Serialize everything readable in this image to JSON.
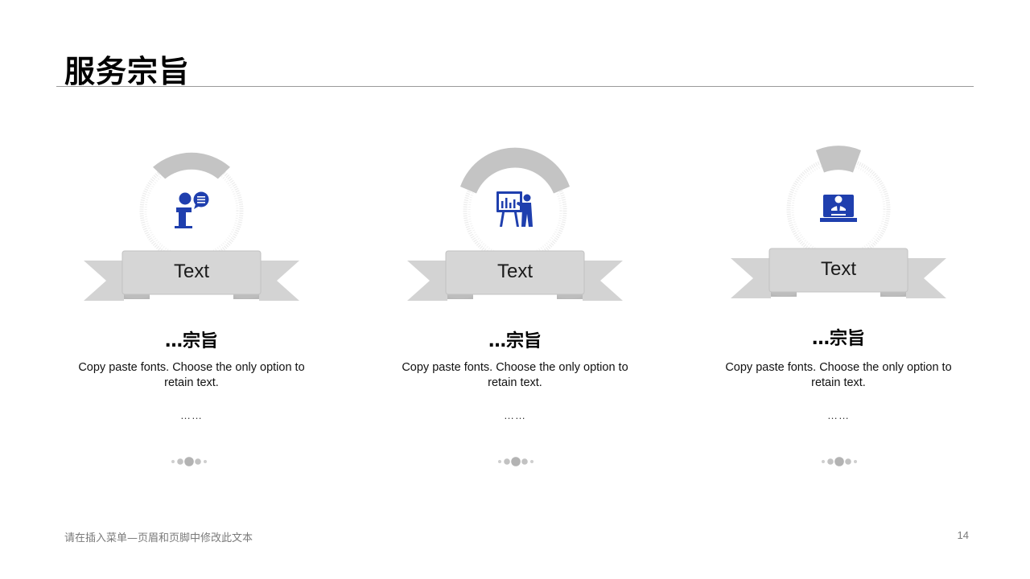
{
  "slide": {
    "title": "服务宗旨",
    "footer": "请在插入菜单—页眉和页脚中修改此文本",
    "page_number": "14"
  },
  "colors": {
    "accent": "#1f3fae",
    "ribbon": "#cfcfcf",
    "arc": "#c4c4c4",
    "rule": "#9a9a9a"
  },
  "columns": [
    {
      "icon": "speaker-podium-icon",
      "ribbon_label": "Text",
      "heading": "…宗旨",
      "description": "Copy paste fonts. Choose the only option to retain text.",
      "ellipsis": "……"
    },
    {
      "icon": "presentation-board-icon",
      "ribbon_label": "Text",
      "heading": "…宗旨",
      "description": "Copy paste fonts. Choose the only option to retain text.",
      "ellipsis": "……"
    },
    {
      "icon": "reception-desk-icon",
      "ribbon_label": "Text",
      "heading": "…宗旨",
      "description": "Copy paste fonts. Choose the only option to retain text.",
      "ellipsis": "……"
    }
  ]
}
